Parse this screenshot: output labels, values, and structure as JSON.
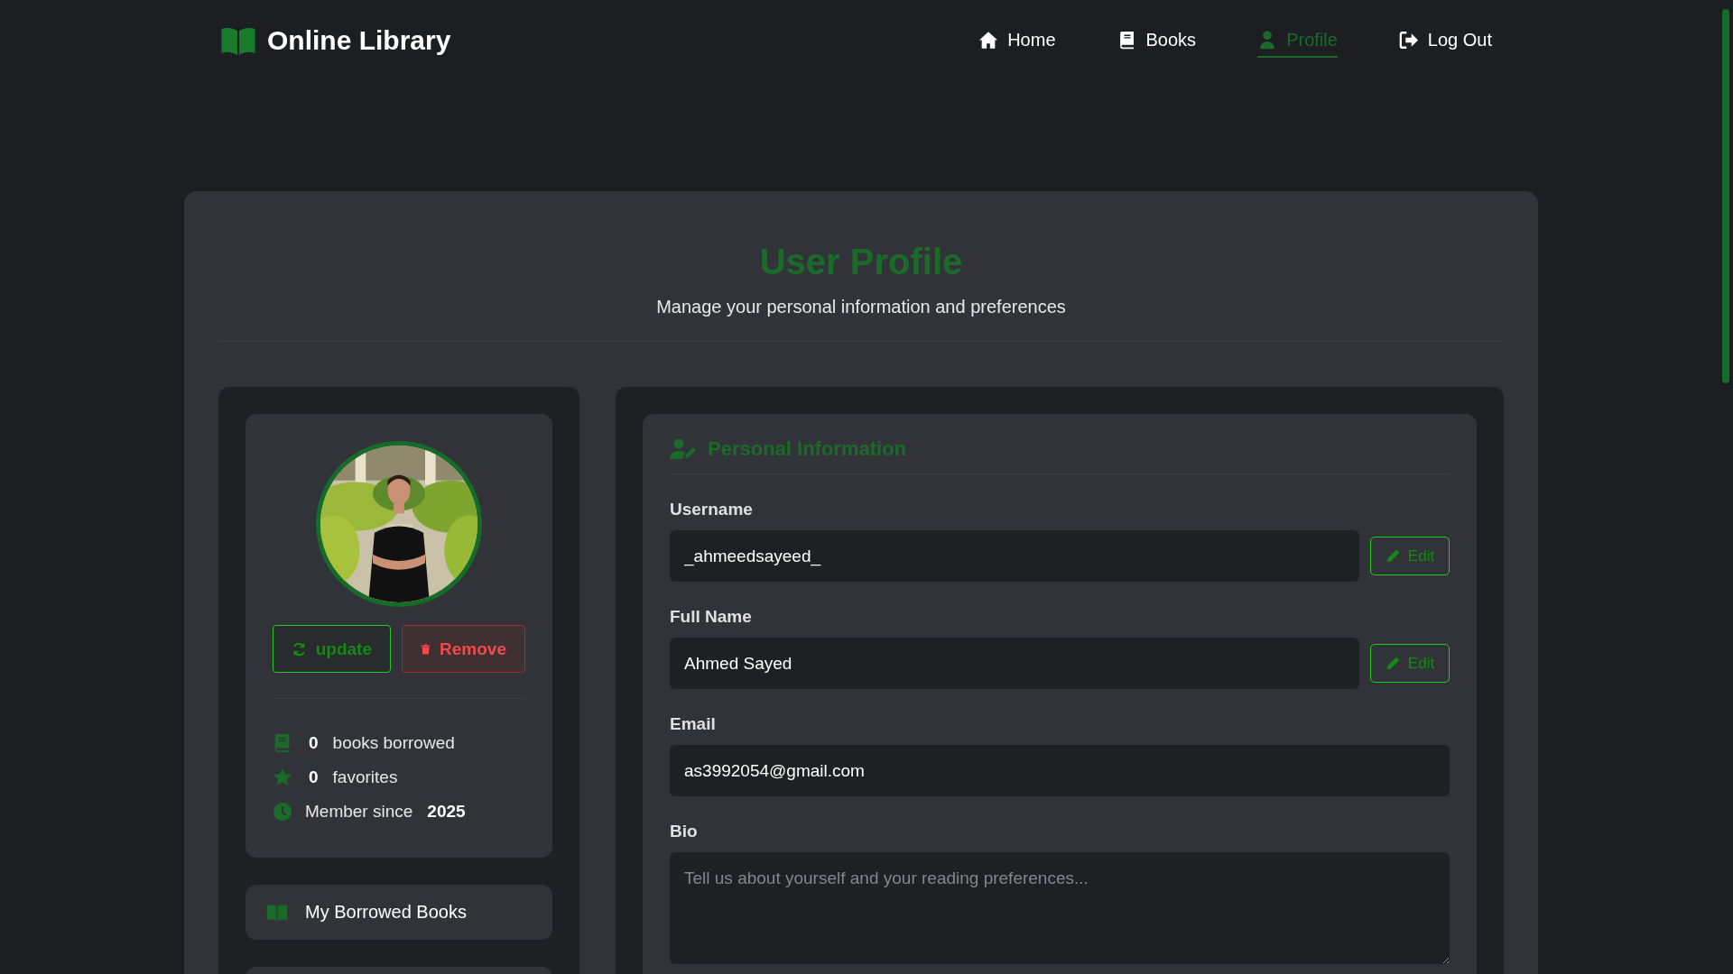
{
  "brand": {
    "title": "Online Library"
  },
  "nav": [
    {
      "label": "Home",
      "selected": false
    },
    {
      "label": "Books",
      "selected": false
    },
    {
      "label": "Profile",
      "selected": true
    },
    {
      "label": "Log Out",
      "selected": false
    }
  ],
  "header": {
    "title": "User Profile",
    "subtitle": "Manage your personal information and preferences"
  },
  "profile_card": {
    "buttons": [
      {
        "label": "update",
        "kind": "primary"
      },
      {
        "label": "Remove",
        "kind": "danger"
      }
    ],
    "stats": [
      {
        "kind": "count",
        "value": "0",
        "label": "books borrowed"
      },
      {
        "kind": "count",
        "value": "0",
        "label": "favorites"
      },
      {
        "kind": "since",
        "label": "Member since",
        "value": "2025"
      }
    ]
  },
  "side_links": [
    {
      "label": "My Borrowed Books"
    }
  ],
  "personal_info": {
    "title": "Personal Information",
    "fields": [
      {
        "kind": "input",
        "label": "Username",
        "value": "_ahmeedsayeed_",
        "action": "Edit"
      },
      {
        "kind": "input",
        "label": "Full Name",
        "value": "Ahmed Sayed",
        "action": "Edit"
      },
      {
        "kind": "input",
        "label": "Email",
        "value": "as3992054@gmail.com"
      },
      {
        "kind": "textarea",
        "label": "Bio",
        "placeholder": "Tell us about yourself and your reading preferences..."
      }
    ]
  }
}
